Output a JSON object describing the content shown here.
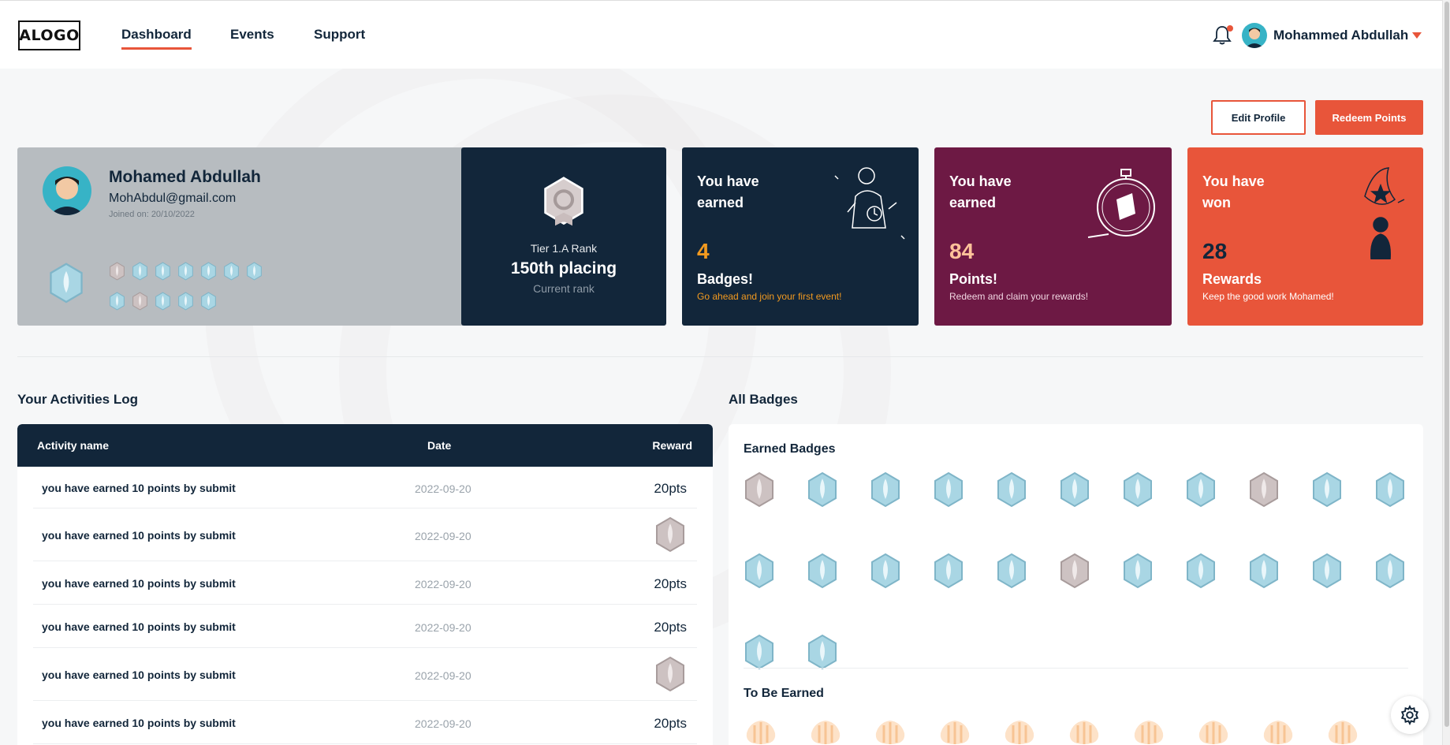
{
  "nav": {
    "logo": "ALOGO",
    "links": [
      "Dashboard",
      "Events",
      "Support"
    ],
    "user_name": "Mohammed Abdullah"
  },
  "actions": {
    "edit_profile": "Edit Profile",
    "redeem_points": "Redeem Points"
  },
  "profile": {
    "name": "Mohamed Abdullah",
    "email": "MohAbdul@gmail.com",
    "joined": "Joined on: 20/10/2022"
  },
  "rank": {
    "tier": "Tier 1.A Rank",
    "placing": "150th placing",
    "label": "Current rank"
  },
  "stats": [
    {
      "line1": "You have earned",
      "value": "4",
      "unit": "Badges!",
      "sub": "Go ahead and join your first event!"
    },
    {
      "line1": "You have earned",
      "value": "84",
      "unit": "Points!",
      "sub": "Redeem and claim your rewards!"
    },
    {
      "line1": "You have won",
      "value": "28",
      "unit": "Rewards",
      "sub": "Keep the good work Mohamed!"
    }
  ],
  "activities": {
    "title": "Your Activities Log",
    "columns": {
      "name": "Activity name",
      "date": "Date",
      "reward": "Reward"
    },
    "rows": [
      {
        "name": "you have earned 10 points by submit",
        "date": "2022-09-20",
        "reward": "20pts"
      },
      {
        "name": "you have earned 10 points by submit",
        "date": "2022-09-20",
        "reward": "badge"
      },
      {
        "name": "you have earned 10 points by submit",
        "date": "2022-09-20",
        "reward": "20pts"
      },
      {
        "name": "you have earned 10 points by submit",
        "date": "2022-09-20",
        "reward": "20pts"
      },
      {
        "name": "you have earned 10 points by submit",
        "date": "2022-09-20",
        "reward": "badge"
      },
      {
        "name": "you have earned 10 points by submit",
        "date": "2022-09-20",
        "reward": "20pts"
      }
    ]
  },
  "badges": {
    "title": "All Badges",
    "earned_title": "Earned Badges",
    "to_be_earned_title": "To Be Earned",
    "earned": [
      "silver",
      "blue",
      "blue",
      "blue",
      "blue",
      "blue",
      "blue",
      "blue",
      "silver",
      "blue",
      "blue",
      "blue",
      "blue",
      "blue",
      "blue",
      "blue",
      "silver",
      "blue",
      "blue",
      "blue",
      "blue",
      "blue",
      "blue",
      "blue"
    ],
    "to_be_earned_count": 10
  },
  "profile_mini_badges": [
    "silver",
    "blue",
    "blue",
    "blue",
    "blue",
    "blue",
    "blue",
    "blue",
    "silver",
    "blue",
    "blue",
    "blue"
  ],
  "colors": {
    "accent": "#e8553a",
    "navy": "#12263a",
    "plum": "#6d1944",
    "gold": "#f39a1f",
    "badge_blue": "#a9d6e4",
    "badge_silver": "#c9bdbd"
  }
}
